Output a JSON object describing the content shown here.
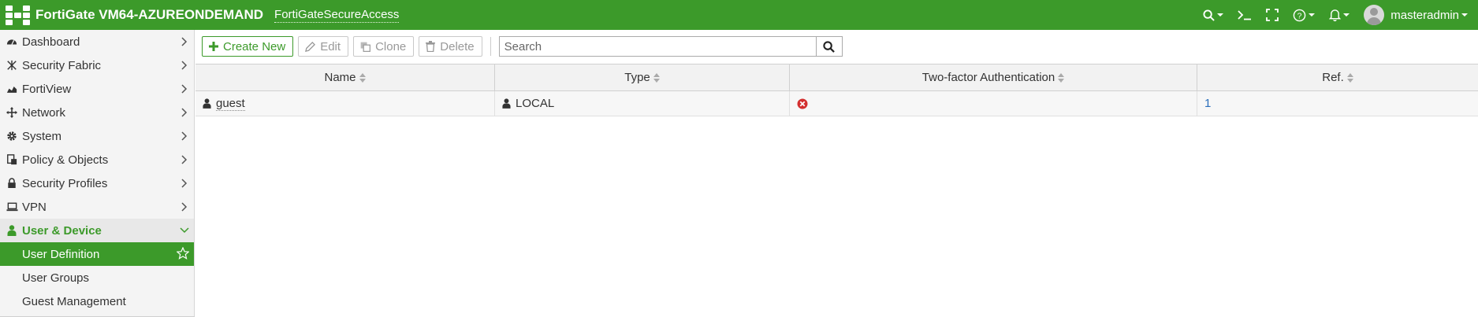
{
  "header": {
    "device_name": "FortiGate VM64-AZUREONDEMAND",
    "vdom_label": "FortiGateSecureAccess",
    "username": "masteradmin",
    "colors": {
      "brand_green": "#3c9a2a"
    }
  },
  "sidebar": {
    "items": [
      {
        "label": "Dashboard",
        "icon": "dashboard-icon"
      },
      {
        "label": "Security Fabric",
        "icon": "security-fabric-icon"
      },
      {
        "label": "FortiView",
        "icon": "fortiview-icon"
      },
      {
        "label": "Network",
        "icon": "network-icon"
      },
      {
        "label": "System",
        "icon": "gear-icon"
      },
      {
        "label": "Policy & Objects",
        "icon": "policy-icon"
      },
      {
        "label": "Security Profiles",
        "icon": "lock-icon"
      },
      {
        "label": "VPN",
        "icon": "laptop-icon"
      },
      {
        "label": "User & Device",
        "icon": "user-icon"
      }
    ],
    "sub_items": [
      {
        "label": "User Definition",
        "selected": true
      },
      {
        "label": "User Groups"
      },
      {
        "label": "Guest Management"
      }
    ]
  },
  "toolbar": {
    "create_new": "Create New",
    "edit": "Edit",
    "clone": "Clone",
    "delete": "Delete",
    "search_placeholder": "Search"
  },
  "table": {
    "columns": [
      "Name",
      "Type",
      "Two-factor Authentication",
      "Ref."
    ],
    "rows": [
      {
        "name": "guest",
        "type": "LOCAL",
        "two_factor": "disabled",
        "ref": "1"
      }
    ]
  }
}
